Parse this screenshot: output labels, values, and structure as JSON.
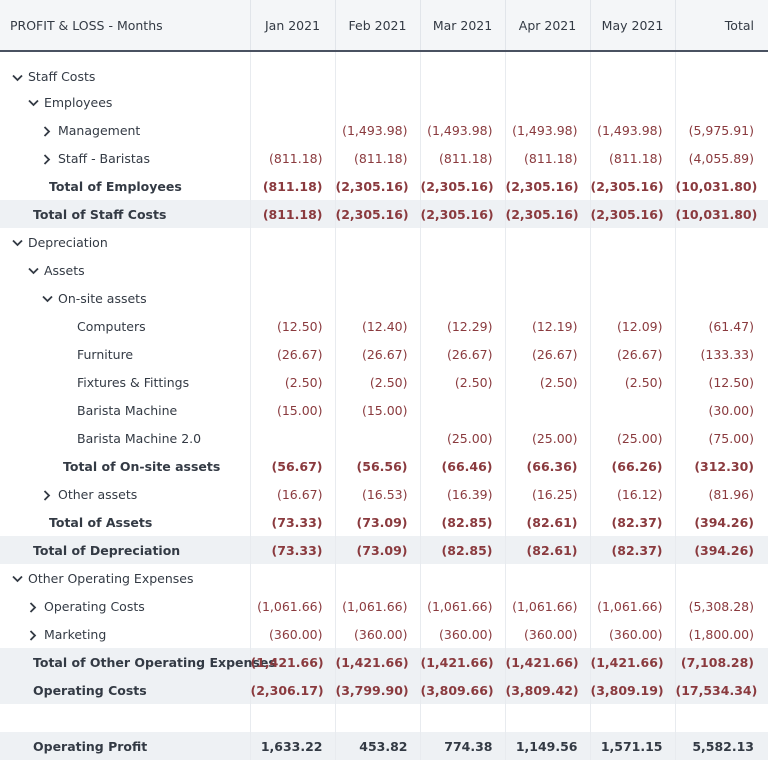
{
  "header": {
    "title": "PROFIT & LOSS - Months",
    "months": [
      "Jan 2021",
      "Feb 2021",
      "Mar 2021",
      "Apr 2021",
      "May 2021"
    ],
    "total": "Total"
  },
  "rows": [
    {
      "label": "Staff Costs",
      "indent": 0,
      "toggle": "expanded",
      "values": [
        "",
        "",
        "",
        "",
        "",
        ""
      ]
    },
    {
      "label": "Employees",
      "indent": 1,
      "toggle": "expanded",
      "values": [
        "",
        "",
        "",
        "",
        "",
        ""
      ]
    },
    {
      "label": "Management",
      "indent": 2,
      "toggle": "collapsed",
      "values": [
        "",
        "(1,493.98)",
        "(1,493.98)",
        "(1,493.98)",
        "(1,493.98)",
        "(5,975.91)"
      ]
    },
    {
      "label": "Staff - Baristas",
      "indent": 2,
      "toggle": "collapsed",
      "values": [
        "(811.18)",
        "(811.18)",
        "(811.18)",
        "(811.18)",
        "(811.18)",
        "(4,055.89)"
      ]
    },
    {
      "label": "Total of Employees",
      "indent": 2,
      "toggle": "none",
      "style": "total",
      "values": [
        "(811.18)",
        "(2,305.16)",
        "(2,305.16)",
        "(2,305.16)",
        "(2,305.16)",
        "(10,031.80)"
      ]
    },
    {
      "label": "Total of Staff Costs",
      "indent": 1,
      "toggle": "none",
      "style": "section-total",
      "values": [
        "(811.18)",
        "(2,305.16)",
        "(2,305.16)",
        "(2,305.16)",
        "(2,305.16)",
        "(10,031.80)"
      ]
    },
    {
      "label": "Depreciation",
      "indent": 0,
      "toggle": "expanded",
      "values": [
        "",
        "",
        "",
        "",
        "",
        ""
      ]
    },
    {
      "label": "Assets",
      "indent": 1,
      "toggle": "expanded",
      "values": [
        "",
        "",
        "",
        "",
        "",
        ""
      ]
    },
    {
      "label": "On-site assets",
      "indent": 2,
      "toggle": "expanded",
      "values": [
        "",
        "",
        "",
        "",
        "",
        ""
      ]
    },
    {
      "label": "Computers",
      "indent": 4,
      "toggle": "none",
      "values": [
        "(12.50)",
        "(12.40)",
        "(12.29)",
        "(12.19)",
        "(12.09)",
        "(61.47)"
      ]
    },
    {
      "label": "Furniture",
      "indent": 4,
      "toggle": "none",
      "values": [
        "(26.67)",
        "(26.67)",
        "(26.67)",
        "(26.67)",
        "(26.67)",
        "(133.33)"
      ]
    },
    {
      "label": "Fixtures & Fittings",
      "indent": 4,
      "toggle": "none",
      "values": [
        "(2.50)",
        "(2.50)",
        "(2.50)",
        "(2.50)",
        "(2.50)",
        "(12.50)"
      ]
    },
    {
      "label": "Barista Machine",
      "indent": 4,
      "toggle": "none",
      "values": [
        "(15.00)",
        "(15.00)",
        "",
        "",
        "",
        "(30.00)"
      ]
    },
    {
      "label": "Barista Machine 2.0",
      "indent": 4,
      "toggle": "none",
      "values": [
        "",
        "",
        "(25.00)",
        "(25.00)",
        "(25.00)",
        "(75.00)"
      ]
    },
    {
      "label": "Total of On-site assets",
      "indent": 3,
      "toggle": "none",
      "style": "total",
      "values": [
        "(56.67)",
        "(56.56)",
        "(66.46)",
        "(66.36)",
        "(66.26)",
        "(312.30)"
      ]
    },
    {
      "label": "Other assets",
      "indent": 2,
      "toggle": "collapsed",
      "values": [
        "(16.67)",
        "(16.53)",
        "(16.39)",
        "(16.25)",
        "(16.12)",
        "(81.96)"
      ]
    },
    {
      "label": "Total of Assets",
      "indent": 2,
      "toggle": "none",
      "style": "total",
      "values": [
        "(73.33)",
        "(73.09)",
        "(82.85)",
        "(82.61)",
        "(82.37)",
        "(394.26)"
      ]
    },
    {
      "label": "Total of Depreciation",
      "indent": 1,
      "toggle": "none",
      "style": "section-total",
      "values": [
        "(73.33)",
        "(73.09)",
        "(82.85)",
        "(82.61)",
        "(82.37)",
        "(394.26)"
      ]
    },
    {
      "label": "Other Operating Expenses",
      "indent": 0,
      "toggle": "expanded",
      "values": [
        "",
        "",
        "",
        "",
        "",
        ""
      ]
    },
    {
      "label": "Operating Costs",
      "indent": 1,
      "toggle": "collapsed",
      "values": [
        "(1,061.66)",
        "(1,061.66)",
        "(1,061.66)",
        "(1,061.66)",
        "(1,061.66)",
        "(5,308.28)"
      ]
    },
    {
      "label": "Marketing",
      "indent": 1,
      "toggle": "collapsed",
      "values": [
        "(360.00)",
        "(360.00)",
        "(360.00)",
        "(360.00)",
        "(360.00)",
        "(1,800.00)"
      ]
    },
    {
      "label": "Total of Other Operating Expenses",
      "indent": 1,
      "toggle": "none",
      "style": "section-total",
      "values": [
        "(1,421.66)",
        "(1,421.66)",
        "(1,421.66)",
        "(1,421.66)",
        "(1,421.66)",
        "(7,108.28)"
      ]
    },
    {
      "label": "Operating Costs",
      "indent": 1,
      "toggle": "none",
      "style": "section-total",
      "values": [
        "(2,306.17)",
        "(3,799.90)",
        "(3,809.66)",
        "(3,809.42)",
        "(3,809.19)",
        "(17,534.34)"
      ]
    },
    {
      "label": "",
      "indent": 0,
      "toggle": "none",
      "style": "spacer",
      "values": [
        "",
        "",
        "",
        "",
        "",
        ""
      ]
    },
    {
      "label": "Operating Profit",
      "indent": 1,
      "toggle": "none",
      "style": "grand-total",
      "values": [
        "1,633.22",
        "453.82",
        "774.38",
        "1,149.56",
        "1,571.15",
        "5,582.13"
      ]
    }
  ]
}
